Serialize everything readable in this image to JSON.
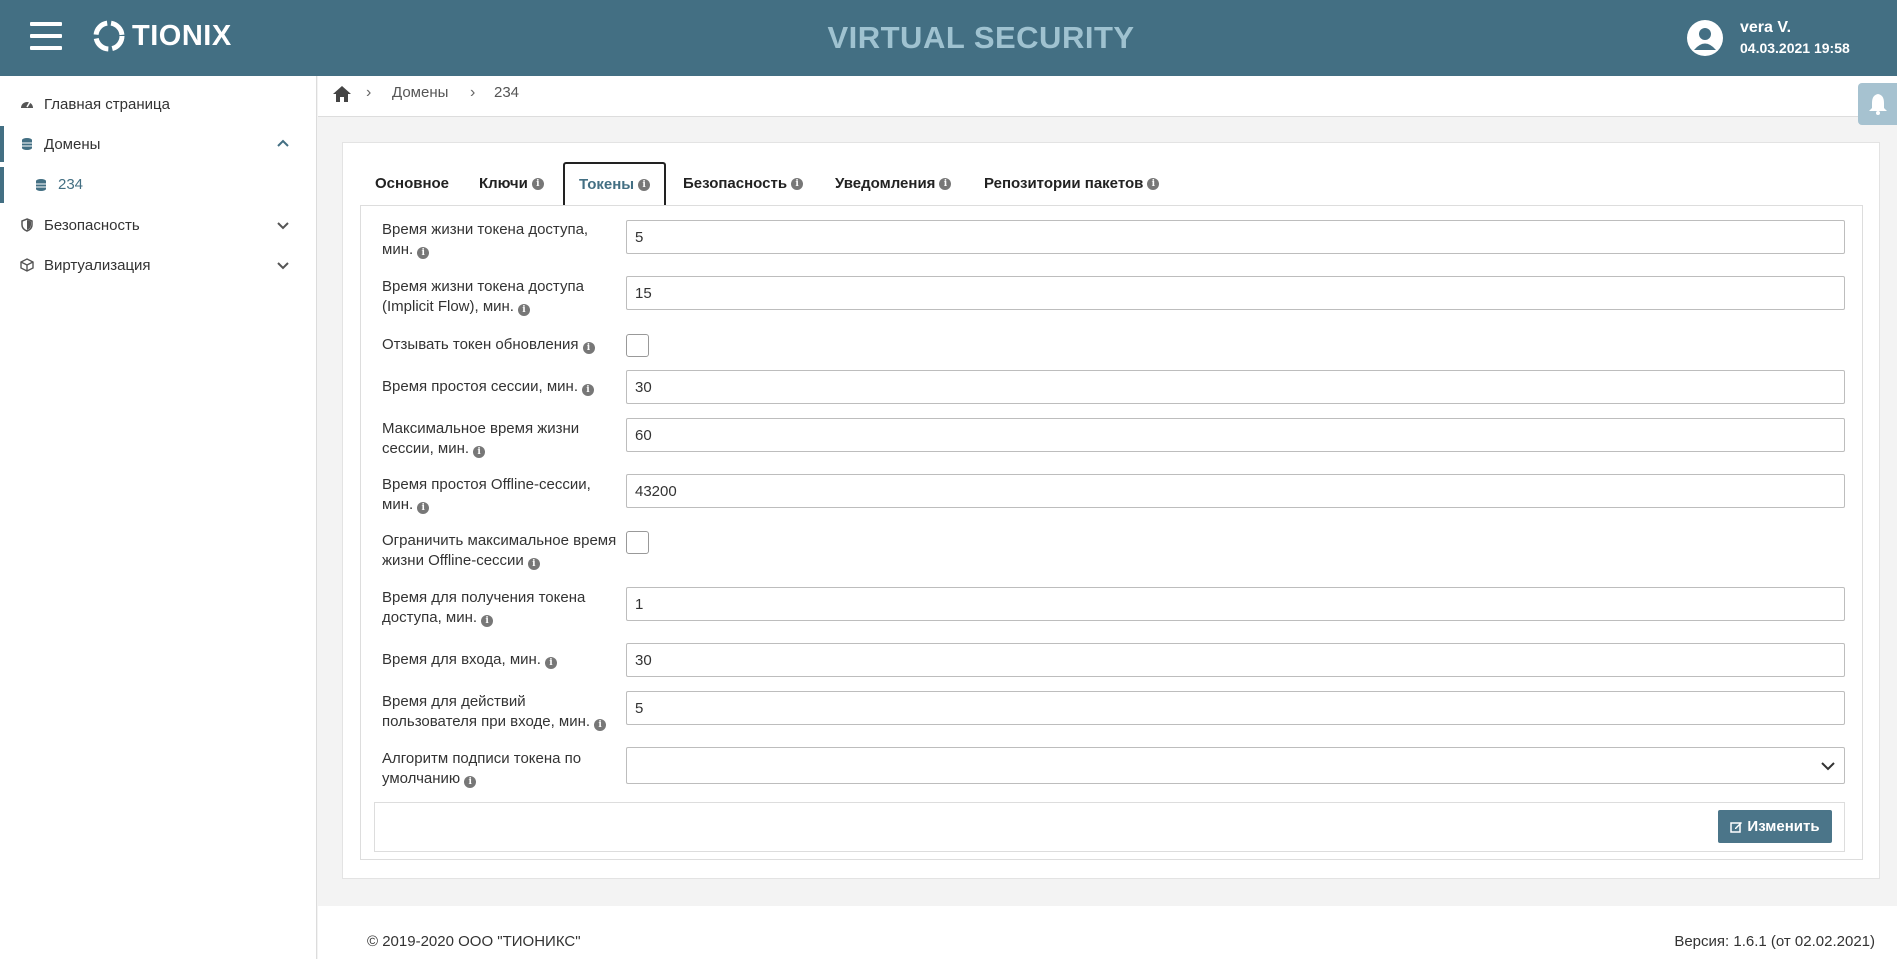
{
  "header": {
    "logo_text": "TIONIX",
    "app_title": "VIRTUAL SECURITY",
    "user_name": "vera V.",
    "user_datetime": "04.03.2021 19:58"
  },
  "sidebar": {
    "items": [
      {
        "label": "Главная страница",
        "icon": "dashboard-icon"
      },
      {
        "label": "Домены",
        "icon": "database-icon",
        "expanded": true
      },
      {
        "label": "234",
        "icon": "database-icon",
        "sub": true
      },
      {
        "label": "Безопасность",
        "icon": "shield-icon"
      },
      {
        "label": "Виртуализация",
        "icon": "cube-icon"
      }
    ]
  },
  "breadcrumb": {
    "items": [
      "Домены",
      "234"
    ]
  },
  "tabs": [
    {
      "label": "Основное",
      "info": false
    },
    {
      "label": "Ключи",
      "info": true
    },
    {
      "label": "Токены",
      "info": true,
      "active": true
    },
    {
      "label": "Безопасность",
      "info": true
    },
    {
      "label": "Уведомления",
      "info": true
    },
    {
      "label": "Репозитории пакетов",
      "info": true
    }
  ],
  "form": {
    "access_token_lifespan": {
      "label_1": "Время жизни токена доступа,",
      "label_2": "мин.",
      "value": "5"
    },
    "access_token_implicit": {
      "label_1": "Время жизни токена доступа",
      "label_2": "(Implicit Flow), мин.",
      "value": "15"
    },
    "revoke_refresh": {
      "label": "Отзывать токен обновления",
      "checked": false
    },
    "session_idle": {
      "label": "Время простоя сессии, мин.",
      "value": "30"
    },
    "session_max": {
      "label_1": "Максимальное время жизни",
      "label_2": "сессии, мин.",
      "value": "60"
    },
    "offline_idle": {
      "label_1": "Время простоя Offline-сессии,",
      "label_2": "мин.",
      "value": "43200"
    },
    "offline_limit": {
      "label_1": "Ограничить максимальное время",
      "label_2": "жизни Offline-сессии",
      "checked": false
    },
    "access_token_get": {
      "label_1": "Время для получения токена",
      "label_2": "доступа, мин.",
      "value": "1"
    },
    "login_time": {
      "label": "Время для входа, мин.",
      "value": "30"
    },
    "login_actions": {
      "label_1": "Время для действий",
      "label_2": "пользователя при входе, мин.",
      "value": "5"
    },
    "signature_alg": {
      "label_1": "Алгоритм подписи токена по",
      "label_2": "умолчанию",
      "value": ""
    }
  },
  "actions": {
    "edit_label": "Изменить"
  },
  "footer": {
    "copyright": "© 2019-2020 ООО \"ТИОНИКС\"",
    "version": "Версия: 1.6.1 (от 02.02.2021)"
  },
  "colors": {
    "header_bg": "#436f83",
    "title_color": "#9fc2d0",
    "accent": "#4b7589"
  }
}
